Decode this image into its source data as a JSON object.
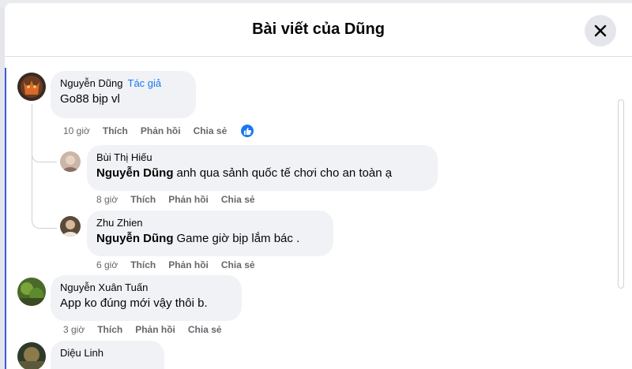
{
  "modal": {
    "title": "Bài viết của Dũng"
  },
  "comments": [
    {
      "author": "Nguyễn Dũng",
      "badge": "Tác giả",
      "text": "Go88 bịp vl",
      "time": "10 giờ",
      "like": "Thích",
      "reply": "Phản hồi",
      "share": "Chia sẻ",
      "reaction": "like-icon"
    },
    {
      "author": "Bùi Thị Hiếu",
      "mention": "Nguyễn Dũng",
      "text": "anh qua sảnh quốc tế chơi cho an toàn ạ",
      "time": "8 giờ",
      "like": "Thích",
      "reply": "Phản hồi",
      "share": "Chia sẻ"
    },
    {
      "author": "Zhu Zhien",
      "mention": "Nguyễn Dũng",
      "text": "Game giờ bịp lắm bác .",
      "time": "6 giờ",
      "like": "Thích",
      "reply": "Phản hồi",
      "share": "Chia sẻ"
    },
    {
      "author": "Nguyễn Xuân Tuấn",
      "text": "App ko đúng mới vậy thôi b.",
      "time": "3 giờ",
      "like": "Thích",
      "reply": "Phản hồi",
      "share": "Chia sẻ"
    },
    {
      "author": "Diệu Linh"
    }
  ],
  "colors": {
    "accent": "#1877f2",
    "bubble": "#f0f2f5",
    "muted": "#65676b"
  }
}
